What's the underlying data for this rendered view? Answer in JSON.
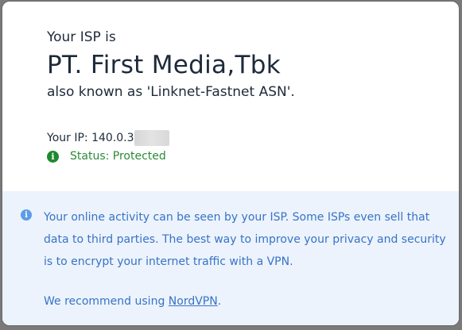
{
  "isp": {
    "intro": "Your ISP is",
    "name": "PT. First Media,Tbk",
    "aka": "also known as 'Linknet-Fastnet ASN'."
  },
  "ip": {
    "label": "Your IP: 140.0.3",
    "masked": true
  },
  "status": {
    "text": "Status: Protected",
    "icon": "info-icon",
    "color": "#1e8a2e"
  },
  "info": {
    "icon": "info-icon",
    "text": "Your online activity can be seen by your ISP. Some ISPs even sell that data to third parties. The best way to improve your privacy and security is to encrypt your internet traffic with a VPN.",
    "recommend_prefix": "We recommend using ",
    "recommend_link": "NordVPN",
    "recommend_suffix": ".",
    "background": "#ecf3fc",
    "text_color": "#3873c6"
  }
}
